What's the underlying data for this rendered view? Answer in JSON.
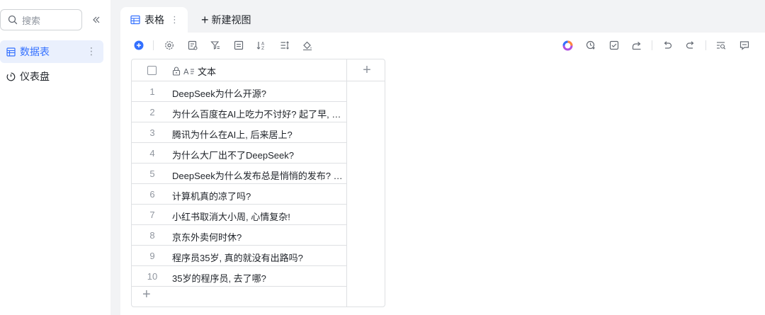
{
  "sidebar": {
    "search_placeholder": "搜索",
    "items": [
      {
        "label": "数据表",
        "icon": "table-icon",
        "active": true
      },
      {
        "label": "仪表盘",
        "icon": "dashboard-icon",
        "active": false
      }
    ]
  },
  "tabs": {
    "active_tab": "表格",
    "new_view_label": "新建视图"
  },
  "toolbar": {
    "left_icons": [
      "add-record-icon",
      "settings-icon",
      "field-config-icon",
      "filter-icon",
      "group-icon",
      "sort-icon",
      "row-height-icon",
      "fill-color-icon"
    ],
    "right_icons": [
      "ai-assistant-icon",
      "automation-icon",
      "checklist-icon",
      "share-icon",
      "undo-icon",
      "redo-icon",
      "search-records-icon",
      "comment-icon"
    ]
  },
  "grid": {
    "column_header": "文本",
    "rows": [
      {
        "num": "1",
        "text": "DeepSeek为什么开源?"
      },
      {
        "num": "2",
        "text": "为什么百度在AI上吃力不讨好? 起了早, 赶了个晚集"
      },
      {
        "num": "3",
        "text": "腾讯为什么在AI上, 后来居上?"
      },
      {
        "num": "4",
        "text": "为什么大厂出不了DeepSeek?"
      },
      {
        "num": "5",
        "text": "DeepSeek为什么发布总是悄悄的发布? 不声不响"
      },
      {
        "num": "6",
        "text": "计算机真的凉了吗?"
      },
      {
        "num": "7",
        "text": "小红书取消大小周, 心情复杂!"
      },
      {
        "num": "8",
        "text": "京东外卖何时休?"
      },
      {
        "num": "9",
        "text": "程序员35岁, 真的就没有出路吗?"
      },
      {
        "num": "10",
        "text": "35岁的程序员, 去了哪?"
      }
    ]
  },
  "colors": {
    "accent": "#3370ff",
    "active_bg": "#eaf0fd",
    "main_bg": "#f2f3f5",
    "border": "#dee0e3"
  }
}
